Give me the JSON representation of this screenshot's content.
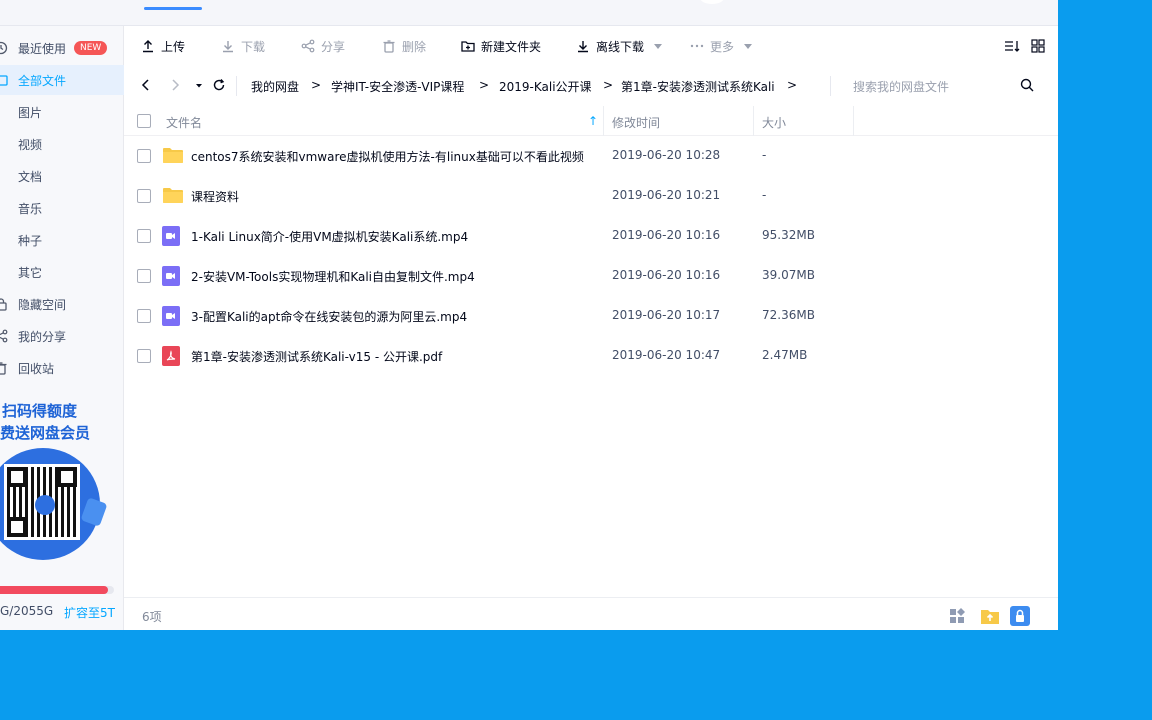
{
  "sidebar": {
    "items": [
      {
        "label": "最近使用",
        "badge": "NEW"
      },
      {
        "label": "全部文件"
      },
      {
        "label": "图片"
      },
      {
        "label": "视频"
      },
      {
        "label": "文档"
      },
      {
        "label": "音乐"
      },
      {
        "label": "种子"
      },
      {
        "label": "其它"
      },
      {
        "label": "隐藏空间"
      },
      {
        "label": "我的分享"
      },
      {
        "label": "回收站"
      }
    ],
    "promo_line1": "扫码得额度",
    "promo_line2": "费送网盘会员",
    "quota_text": "G/2055G",
    "quota_link": "扩容至5T",
    "quota_used_fraction": 0.95,
    "accent": "#06a7ff",
    "quota_color": "#f24a5e"
  },
  "toolbar": {
    "upload": "上传",
    "download": "下载",
    "share": "分享",
    "delete": "删除",
    "new_folder": "新建文件夹",
    "offline_download": "离线下载",
    "more": "更多"
  },
  "path": {
    "crumbs": [
      "我的网盘",
      "学神IT-安全渗透-VIP课程",
      "2019-Kali公开课",
      "第1章-安装渗透测试系统Kali"
    ],
    "separator": ">",
    "search_placeholder": "搜索我的网盘文件"
  },
  "table": {
    "headers": {
      "name": "文件名",
      "modified": "修改时间",
      "size": "大小"
    },
    "rows": [
      {
        "type": "folder",
        "name": "centos7系统安装和vmware虚拟机使用方法-有linux基础可以不看此视频",
        "time": "2019-06-20 10:28",
        "size": "-"
      },
      {
        "type": "folder",
        "name": "课程资料",
        "time": "2019-06-20 10:21",
        "size": "-"
      },
      {
        "type": "video",
        "name": "1-Kali Linux简介-使用VM虚拟机安装Kali系统.mp4",
        "time": "2019-06-20 10:16",
        "size": "95.32MB"
      },
      {
        "type": "video",
        "name": "2-安装VM-Tools实现物理机和Kali自由复制文件.mp4",
        "time": "2019-06-20 10:16",
        "size": "39.07MB"
      },
      {
        "type": "video",
        "name": "3-配置Kali的apt命令在线安装包的源为阿里云.mp4",
        "time": "2019-06-20 10:17",
        "size": "72.36MB"
      },
      {
        "type": "pdf",
        "name": "第1章-安装渗透测试系统Kali-v15 - 公开课.pdf",
        "time": "2019-06-20 10:47",
        "size": "2.47MB"
      }
    ]
  },
  "footer": {
    "count": "6项"
  }
}
